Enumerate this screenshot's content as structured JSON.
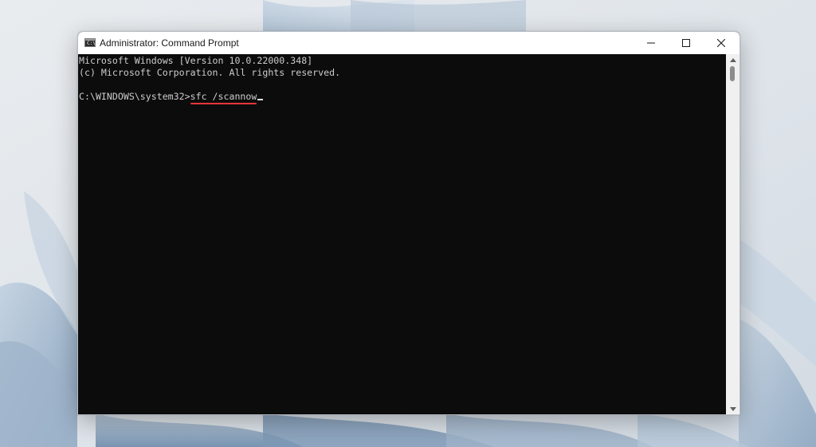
{
  "window": {
    "title": "Administrator: Command Prompt",
    "icon_label": "C:\\"
  },
  "titlebar_buttons": {
    "minimize": "minimize-icon",
    "maximize": "maximize-icon",
    "close": "close-icon"
  },
  "console": {
    "line1": "Microsoft Windows [Version 10.0.22000.348]",
    "line2": "(c) Microsoft Corporation. All rights reserved.",
    "prompt": "C:\\WINDOWS\\system32>",
    "command": "sfc /scannow"
  },
  "colors": {
    "console_bg": "#0c0c0c",
    "console_text": "#cccccc",
    "underline": "#e8353b",
    "titlebar_bg": "#ffffff"
  }
}
